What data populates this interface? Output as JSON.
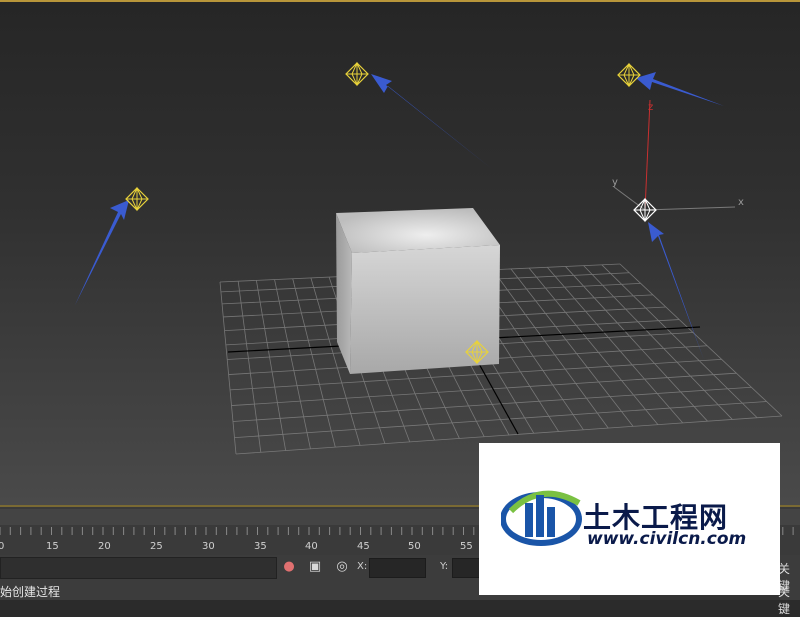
{
  "viewport": {
    "axis_labels": {
      "x": "x",
      "y": "y",
      "z": "z"
    }
  },
  "timeline": {
    "ticks": [
      "0",
      "15",
      "20",
      "25",
      "30",
      "35",
      "40",
      "45",
      "50",
      "55"
    ]
  },
  "statusbar": {
    "x_label": "X:",
    "y_label": "Y:",
    "prompt": "始创建过程",
    "key_label_1": "关键",
    "key_label_2": "关键",
    "icons": [
      "light-bulb-icon",
      "lock-icon",
      "select-transform-icon"
    ]
  },
  "watermark": {
    "title": "土木工程网",
    "url": "www.civilcn.com"
  },
  "colors": {
    "light_icon": "#e8d23a",
    "selected_light": "#ffffff",
    "arrow": "#3a5bd0",
    "accent_border": "#b8963a"
  }
}
